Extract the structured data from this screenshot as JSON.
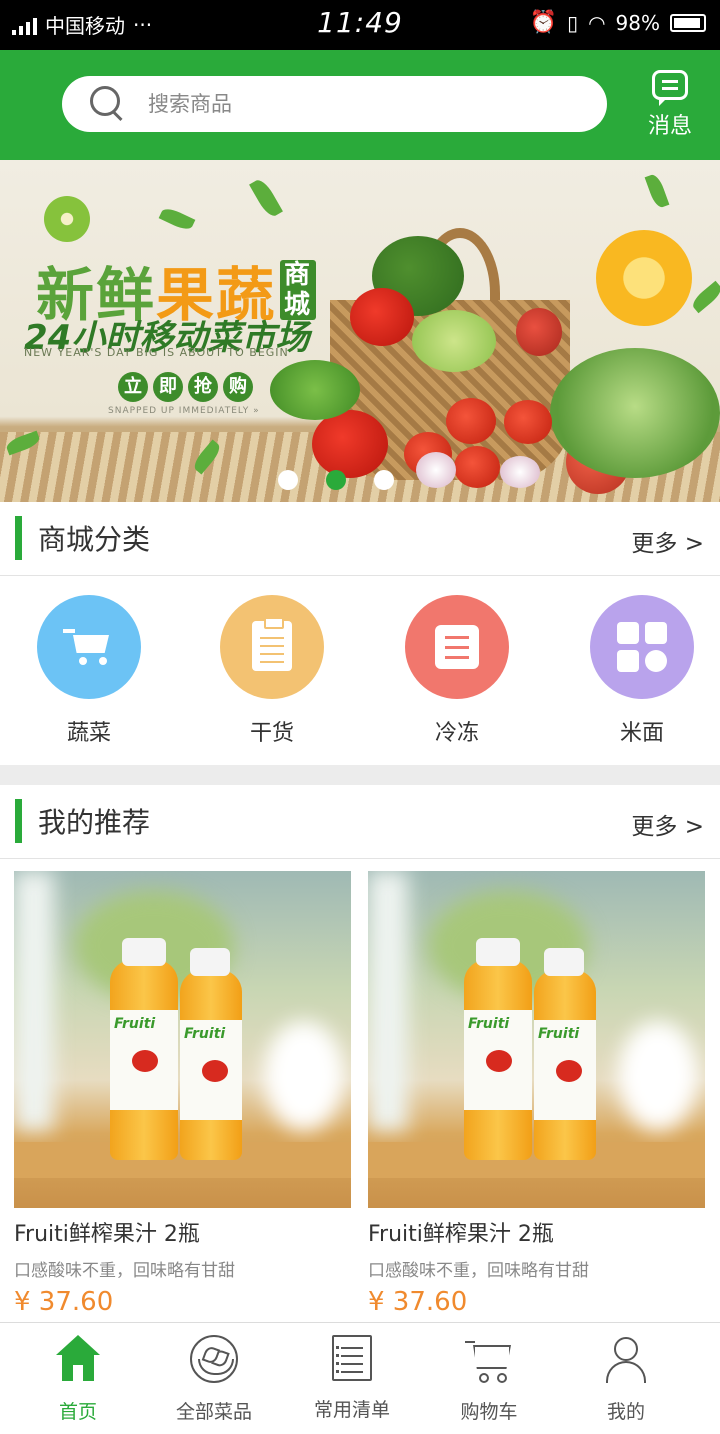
{
  "status_bar": {
    "carrier": "中国移动",
    "extra": "···",
    "time": "11:49",
    "battery": "98%"
  },
  "header": {
    "search_placeholder": "搜索商品",
    "message_label": "消息"
  },
  "banner": {
    "title_part1": "新鲜",
    "title_part2": "果蔬",
    "title_badge": "商城",
    "subtitle": "24小时移动菜市场",
    "english_line": "NEW YEAR'S DAY BIG IS ABOUT TO BEGIN",
    "cta": [
      "立",
      "即",
      "抢",
      "购"
    ],
    "cta_english": "SNAPPED UP IMMEDIATELY »",
    "active_slide": 2,
    "slide_count": 3
  },
  "category_section": {
    "title": "商城分类",
    "more": "更多  >",
    "items": [
      {
        "label": "蔬菜",
        "color": "#6cc3f5",
        "icon": "cart-icon"
      },
      {
        "label": "干货",
        "color": "#f3c272",
        "icon": "clipboard-icon"
      },
      {
        "label": "冷冻",
        "color": "#f1776d",
        "icon": "list-icon"
      },
      {
        "label": "米面",
        "color": "#b9a3ec",
        "icon": "grid-icon"
      }
    ]
  },
  "recommend_section": {
    "title": "我的推荐",
    "more": "更多  >",
    "products": [
      {
        "name": "Fruiti鲜榨果汁   2瓶",
        "desc": "口感酸味不重，回味略有甘甜",
        "price": "¥ 37.60",
        "brand": "Fruiti"
      },
      {
        "name": "Fruiti鲜榨果汁   2瓶",
        "desc": "口感酸味不重，回味略有甘甜",
        "price": "¥ 37.60",
        "brand": "Fruiti"
      }
    ]
  },
  "tabbar": {
    "tabs": [
      {
        "label": "首页",
        "icon": "home-icon",
        "active": true
      },
      {
        "label": "全部菜品",
        "icon": "bowl-icon",
        "active": false
      },
      {
        "label": "常用清单",
        "icon": "list-icon",
        "active": false
      },
      {
        "label": "购物车",
        "icon": "cart-icon",
        "active": false
      },
      {
        "label": "我的",
        "icon": "user-icon",
        "active": false
      }
    ]
  },
  "colors": {
    "primary": "#2aaa3a",
    "price": "#f08a2e"
  }
}
